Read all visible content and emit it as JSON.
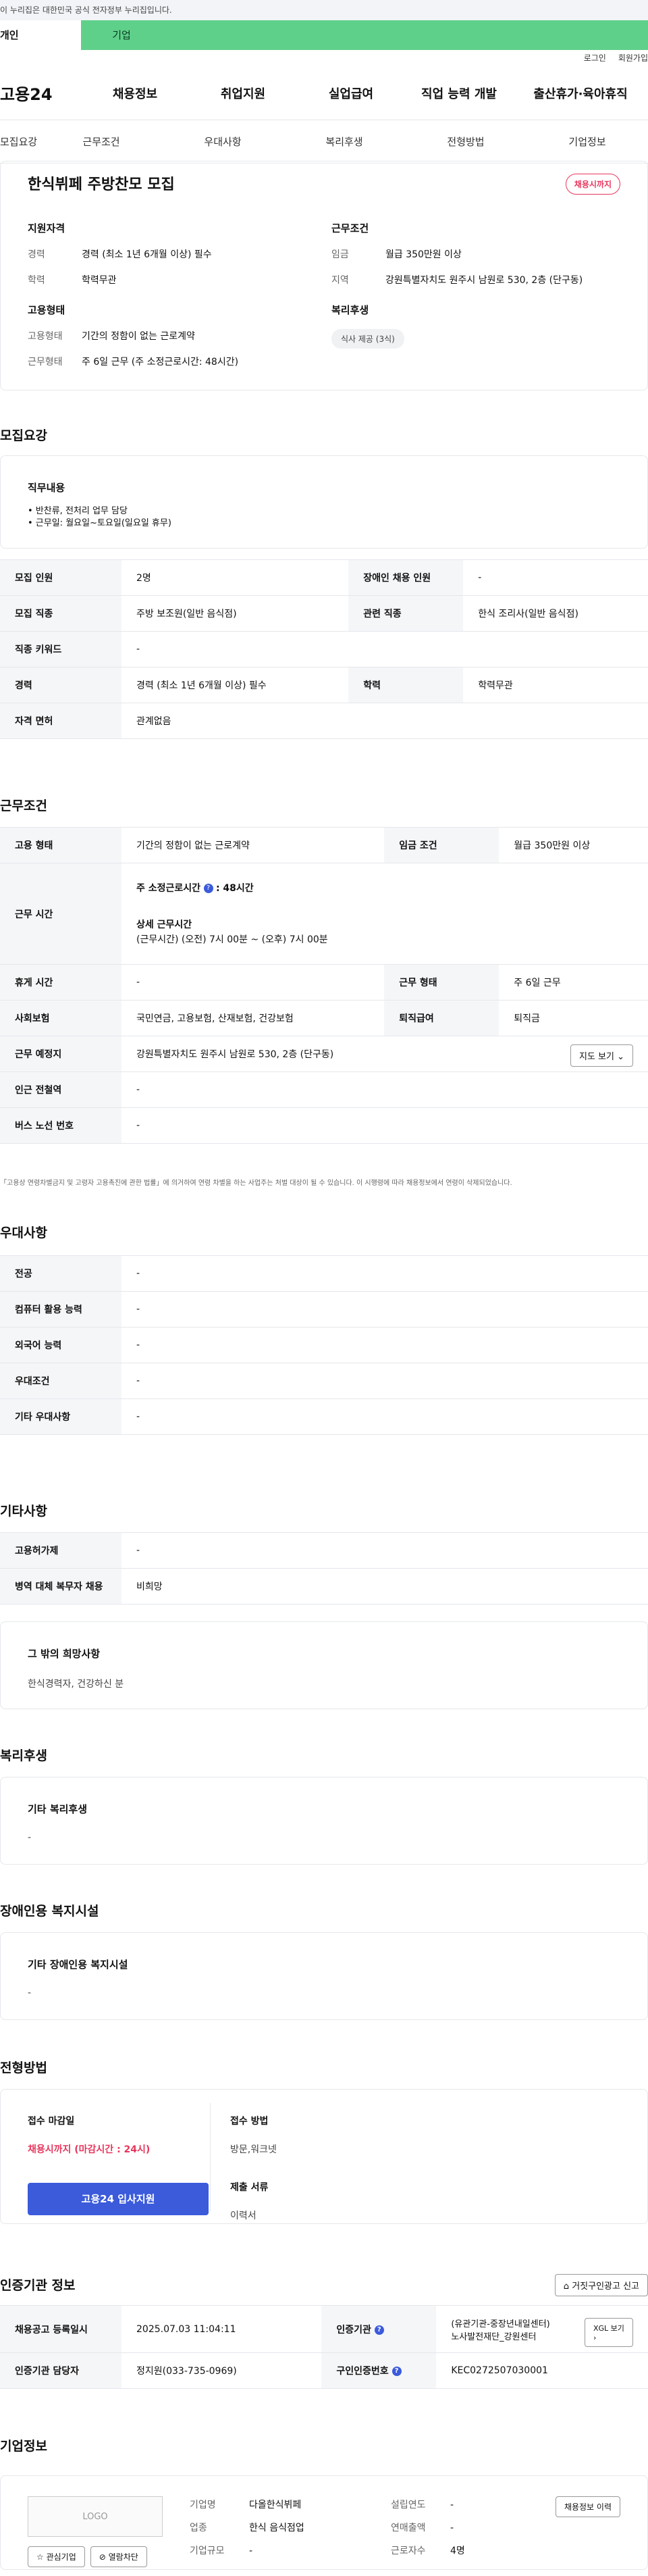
{
  "gov_banner": "이 누리집은 대한민국 공식 전자정부 누리집입니다.",
  "user_tabs": [
    "개인",
    "기업"
  ],
  "util": [
    "로그인",
    "회원가입"
  ],
  "logo": "고용24",
  "gnb": [
    "채용정보",
    "취업지원",
    "실업급여",
    "직업 능력 개발",
    "출산휴가·육아휴직"
  ],
  "lnb": [
    "모집요강",
    "근무조건",
    "우대사항",
    "복리후생",
    "전형방법",
    "기업정보"
  ],
  "job": {
    "title": "한식뷔페 주방찬모 모집",
    "status": "채용시까지",
    "qual_title": "지원자격",
    "qual": [
      {
        "k": "경력",
        "v": "경력 (최소 1년 6개월 이상) 필수"
      },
      {
        "k": "학력",
        "v": "학력무관"
      }
    ],
    "cond_title": "근무조건",
    "cond": [
      {
        "k": "임금",
        "v": "월급 350만원 이상"
      },
      {
        "k": "지역",
        "v": "강원특별자치도 원주시 남원로 530, 2층 (단구동)"
      }
    ],
    "emp_title": "고용형태",
    "emp": [
      {
        "k": "고용형태",
        "v": "기간의 정함이 없는 근로계약"
      },
      {
        "k": "근무형태",
        "v": "주 6일 근무 (주 소정근로시간: 48시간)"
      }
    ],
    "wel_title": "복리후생",
    "wel_chip": "식사 제공 (3식)"
  },
  "recruit": {
    "title": "모집요강",
    "duty_title": "직무내용",
    "duties": [
      "• 반찬류, 전처리 업무 담당",
      "• 근무일: 월요일~토요일(일요일 휴무)"
    ],
    "rows": [
      [
        "모집 인원",
        "2명",
        "장애인 채용 인원",
        "-"
      ],
      [
        "모집 직종",
        "주방 보조원(일반 음식점)",
        "관련 직종",
        "한식 조리사(일반 음식점)"
      ],
      [
        "직종 키워드",
        "-"
      ],
      [
        "경력",
        "경력 (최소 1년 6개월 이상) 필수",
        "학력",
        "학력무관"
      ],
      [
        "자격 면허",
        "관계없음"
      ]
    ]
  },
  "work": {
    "title": "근무조건",
    "r1": [
      "고용 형태",
      "기간의 정함이 없는 근로계약",
      "임금 조건",
      "월급 350만원 이상"
    ],
    "time_h": "근무 시간",
    "time_a": "주 소정근로시간",
    "time_a_v": ": 48시간",
    "time_b": "상세 근무시간",
    "time_b_v": "(근무시간) (오전) 7시 00분 ~ (오후) 7시 00분",
    "r3": [
      "휴게 시간",
      "-",
      "근무 형태",
      "주 6일 근무"
    ],
    "r4": [
      "사회보험",
      "국민연금, 고용보험, 산재보험, 건강보험",
      "퇴직급여",
      "퇴직금"
    ],
    "r5": [
      "근무 예정지",
      "강원특별자치도 원주시 남원로 530, 2층 (단구동)"
    ],
    "map_btn": "지도 보기",
    "r6": [
      "인근 전철역",
      "-"
    ],
    "r7": [
      "버스 노선 번호",
      "-"
    ],
    "note": "「고용상 연령차별금지 및 고령자 고용촉진에 관한 법률」에 의거하여 연령 차별을 하는 사업주는 처벌 대상이 될 수 있습니다. 이 시행령에 따라 채용정보에서 연령이 삭제되었습니다."
  },
  "pref": {
    "title": "우대사항",
    "rows": [
      [
        "전공",
        "-"
      ],
      [
        "컴퓨터 활용 능력",
        "-"
      ],
      [
        "외국어 능력",
        "-"
      ],
      [
        "우대조건",
        "-"
      ],
      [
        "기타 우대사항",
        "-"
      ]
    ]
  },
  "etc": {
    "title": "기타사항",
    "rows": [
      [
        "고용허가제",
        "-"
      ],
      [
        "병역 대체 복무자 채용",
        "비희망"
      ]
    ],
    "hope_t": "그 밖의 희망사항",
    "hope_v": "한식경력자, 건강하신 분"
  },
  "welfare": {
    "title": "복리후생",
    "t": "기타 복리후생",
    "v": "-"
  },
  "disab": {
    "title": "장애인용 복지시설",
    "t": "기타 장애인용 복지시설",
    "v": "-"
  },
  "process": {
    "title": "전형방법",
    "deadline_t": "접수 마감일",
    "deadline_v": "채용시까지 (마감시간 : 24시)",
    "apply_btn": "고용24 입사지원",
    "method_t": "접수 방법",
    "method_v": "방문,워크넷",
    "docs_t": "제출 서류",
    "docs_v": "이력서"
  },
  "cert": {
    "title": "인증기관 정보",
    "report_btn": "거짓구인광고 신고",
    "r1": [
      "채용공고 등록일시",
      "2025.07.03 11:04:11",
      "인증기관"
    ],
    "cert_org": "(유관기관-중장년내일센터) 노사발전재단_강원센터",
    "xgl": "XGL 보기",
    "r2": [
      "인증기관 담당자",
      "정지원(033-735-0969)",
      "구인인증번호",
      "KEC0272507030001"
    ]
  },
  "company": {
    "title": "기업정보",
    "logo": "LOGO",
    "fav": "관심기업",
    "block": "열람차단",
    "history_btn": "채용정보 이력",
    "rows": [
      [
        "기업명",
        "다올한식뷔페",
        "설립연도",
        "-"
      ],
      [
        "업종",
        "한식 음식점업",
        "연매출액",
        "-"
      ],
      [
        "기업규모",
        "-",
        "근로자수",
        "4명"
      ]
    ]
  }
}
